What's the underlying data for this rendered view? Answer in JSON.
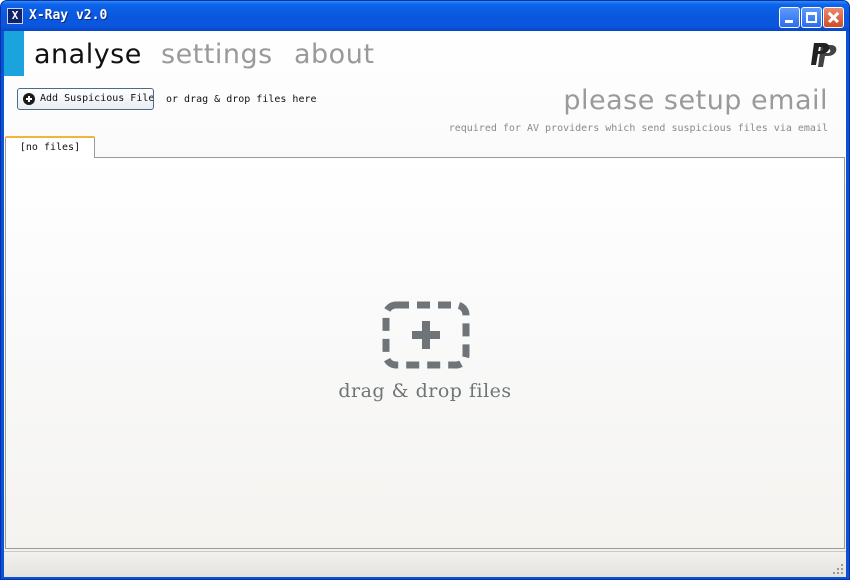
{
  "window": {
    "title": "X-Ray v2.0",
    "icon_letter": "X",
    "icon": "app-x-icon",
    "controls": [
      "minimize-icon",
      "maximize-icon",
      "close-icon"
    ]
  },
  "nav": {
    "tabs": [
      {
        "label": "analyse",
        "active": true
      },
      {
        "label": "settings",
        "active": false
      },
      {
        "label": "about",
        "active": false
      }
    ],
    "logo": "paypal-icon"
  },
  "toolbar": {
    "add_button_label": "Add Suspicious File",
    "add_button_icon": "plus-circle-icon",
    "drag_hint": "or drag & drop files here"
  },
  "email_notice": {
    "title": "please setup email",
    "subtitle": "required for AV providers which send suspicious files via email"
  },
  "files": {
    "tab_label": "[no files]"
  },
  "drop_zone": {
    "icon": "dashed-plus-box-icon",
    "label": "drag & drop files"
  },
  "colors": {
    "accent": "#1aa3dd",
    "titlebar": "#0a55dc",
    "tab_highlight": "#f2b43a",
    "inactive_text": "#9a9a9a",
    "drop_icon": "#6f7478"
  }
}
